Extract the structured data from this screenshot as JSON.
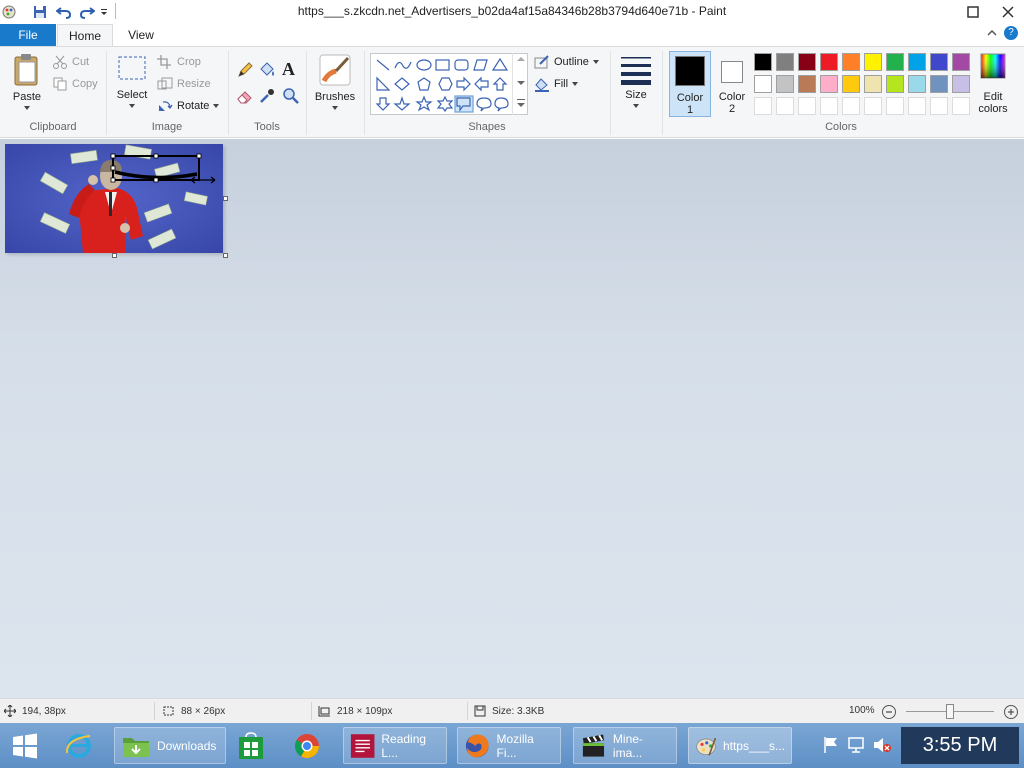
{
  "window": {
    "title": "https___s.zkcdn.net_Advertisers_b02da4af15a84346b28b3794d640e71b - Paint"
  },
  "tabs": {
    "file": "File",
    "home": "Home",
    "view": "View"
  },
  "clipboard": {
    "paste": "Paste",
    "cut": "Cut",
    "copy": "Copy",
    "label": "Clipboard"
  },
  "image": {
    "select": "Select",
    "crop": "Crop",
    "resize": "Resize",
    "rotate": "Rotate",
    "label": "Image"
  },
  "tools": {
    "label": "Tools",
    "text_glyph": "A"
  },
  "brushes": {
    "label": "Brushes"
  },
  "shapes": {
    "outline": "Outline",
    "fill": "Fill",
    "label": "Shapes"
  },
  "size": {
    "label": "Size"
  },
  "color1": {
    "label": "Color",
    "num": "1",
    "value": "#000000"
  },
  "color2": {
    "label": "Color",
    "num": "2",
    "value": "#ffffff"
  },
  "colors": {
    "label": "Colors",
    "edit_label": "Edit",
    "edit_label2": "colors",
    "row1": [
      "#000000",
      "#7f7f7f",
      "#880015",
      "#ed1c24",
      "#ff7f27",
      "#fff200",
      "#22b14c",
      "#00a2e8",
      "#3f48cc",
      "#a349a4"
    ],
    "row2": [
      "#ffffff",
      "#c3c3c3",
      "#b97a57",
      "#ffaec9",
      "#ffc90e",
      "#efe4b0",
      "#b5e61d",
      "#99d9ea",
      "#7092be",
      "#c8bfe7"
    ]
  },
  "status": {
    "cursor_pos": "194, 38px",
    "selection_size": "88 × 26px",
    "image_size": "218 × 109px",
    "file_size": "Size: 3.3KB",
    "zoom": "100%"
  },
  "taskbar": {
    "downloads": "Downloads",
    "reading": "Reading L...",
    "firefox": "Mozilla Fi...",
    "mine": "Mine-ima...",
    "paint": "https___s...",
    "clock": "3:55 PM"
  }
}
